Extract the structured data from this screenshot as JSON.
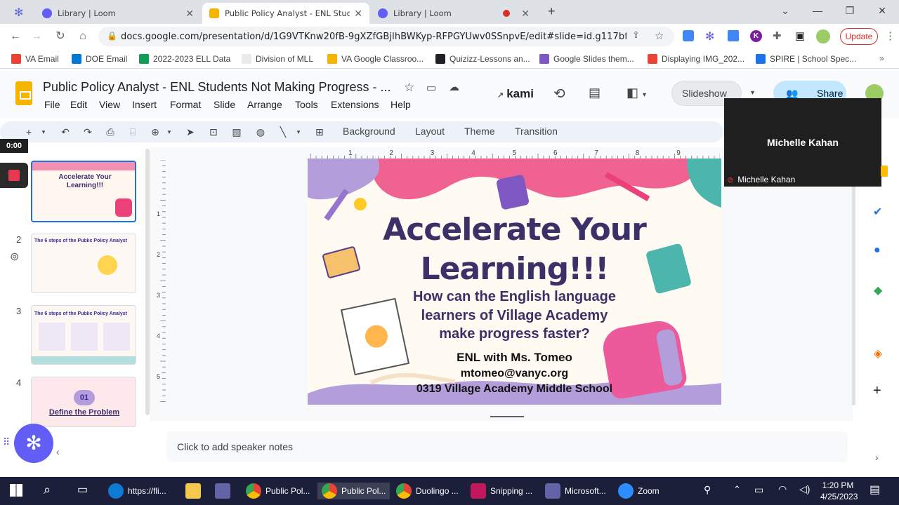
{
  "tabs": [
    {
      "title": "Library | Loom",
      "icon": "loom-icon",
      "active": false
    },
    {
      "title": "Public Policy Analyst - ENL Stude",
      "icon": "slides-icon",
      "active": true
    },
    {
      "title": "Library | Loom",
      "icon": "loom-icon",
      "active": false
    }
  ],
  "address": {
    "url": "docs.google.com/presentation/d/1G9VTKnw20fB-9gXZfGBjlhBWKyp-RFPGYUwv0SSnpvE/edit#slide=id.g117bfa9d...",
    "update_label": "Update"
  },
  "bookmarks": [
    "VA Email",
    "DOE Email",
    "2022-2023 ELL Data",
    "Division of MLL",
    "VA Google Classroo...",
    "Quizizz-Lessons an...",
    "Google Slides them...",
    "Displaying IMG_202...",
    "SPIRE | School Spec..."
  ],
  "doc": {
    "title": "Public Policy Analyst - ENL Students Not Making Progress - ...",
    "kami": "kami",
    "slideshow_label": "Slideshow",
    "share_label": "Share"
  },
  "menu": [
    "File",
    "Edit",
    "View",
    "Insert",
    "Format",
    "Slide",
    "Arrange",
    "Tools",
    "Extensions",
    "Help"
  ],
  "toolbar": {
    "background": "Background",
    "layout": "Layout",
    "theme": "Theme",
    "transition": "Transition"
  },
  "recording": {
    "timer": "0:00"
  },
  "thumbnails": [
    {
      "num": "",
      "title": "Accelerate Your Learning!!!"
    },
    {
      "num": "2",
      "title": "The 6 steps of the Public Policy Analyst"
    },
    {
      "num": "3",
      "title": "The 6 steps of the Public Policy Analyst"
    },
    {
      "num": "4",
      "title": "Define the Problem",
      "badge": "01"
    }
  ],
  "ruler_ticks": [
    "1",
    "2",
    "3",
    "4",
    "5",
    "6",
    "7",
    "8",
    "9"
  ],
  "vruler_ticks": [
    "1",
    "2",
    "3",
    "4",
    "5"
  ],
  "slide": {
    "title_line1": "Accelerate Your",
    "title_line2": "Learning!!!",
    "question_line1": "How can the English language",
    "question_line2": "learners of Village Academy",
    "question_line3": "make progress faster?",
    "teacher": "ENL with Ms. Tomeo",
    "email": "mtomeo@vanyc.org",
    "school": "0319 Village Academy Middle School"
  },
  "notes": {
    "placeholder": "Click to add speaker notes"
  },
  "video": {
    "name_big": "Michelle Kahan",
    "name_small": "Michelle Kahan"
  },
  "taskbar": [
    {
      "label": "https://fli...",
      "icon_color": "#0c7bd1"
    },
    {
      "label": "",
      "icon_color": "#f4c84b"
    },
    {
      "label": "",
      "icon_color": "#6264a7"
    },
    {
      "label": "Public Pol...",
      "icon_color": "#34a853"
    },
    {
      "label": "Public Pol...",
      "icon_color": "#34a853",
      "active": true
    },
    {
      "label": "Duolingo ...",
      "icon_color": "#34a853"
    },
    {
      "label": "Snipping ...",
      "icon_color": "#c2185b"
    },
    {
      "label": "Microsoft...",
      "icon_color": "#6264a7"
    },
    {
      "label": "Zoom",
      "icon_color": "#2d8cff"
    }
  ],
  "clock": {
    "time": "1:20 PM",
    "date": "4/25/2023"
  },
  "colors": {
    "slide_bg": "#fffaf2",
    "pink": "#f06292",
    "purple": "#b39ddb",
    "share_bg": "#c2e7ff",
    "taskbar": "#1b1f3a"
  }
}
